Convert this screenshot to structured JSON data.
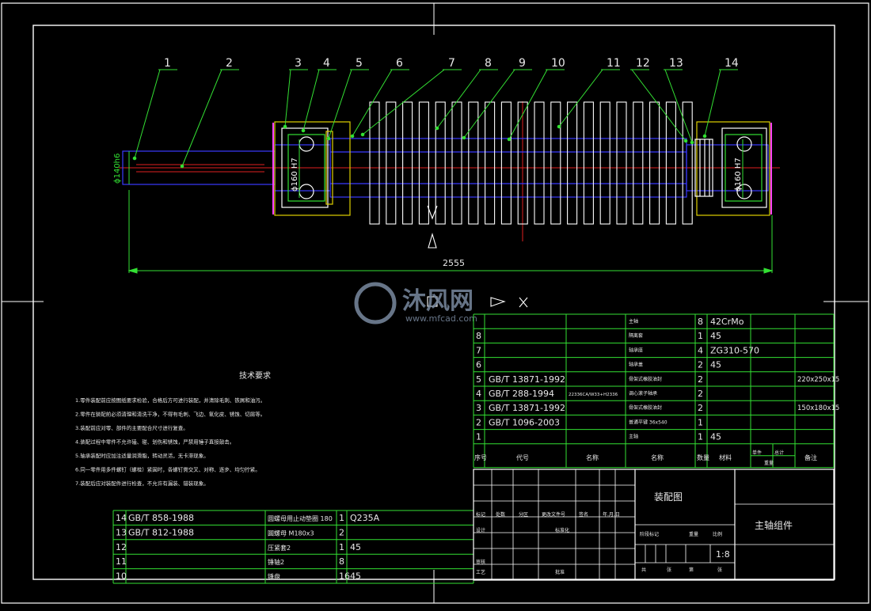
{
  "colors": {
    "background": "#000000",
    "frame": "#ffffff",
    "green": "#33e033",
    "blue": "#3a3aff",
    "red": "#e02020",
    "magenta": "#ff40ff",
    "yellow": "#e0d000",
    "text": "#e8e8e8",
    "watermark": "#7a8aa0"
  },
  "balloons": [
    "1",
    "2",
    "3",
    "4",
    "5",
    "6",
    "7",
    "8",
    "9",
    "10",
    "11",
    "12",
    "13",
    "14"
  ],
  "dimensions": {
    "shaft_diameter": "ϕ140h6",
    "bearing_left": "ϕ160 H7",
    "bearing_right": "ϕ160 H7",
    "overall_length": "2555"
  },
  "watermark": {
    "brand": "沐风网",
    "url": "www.mfcad.com"
  },
  "tech_requirements": {
    "title": "技术要求",
    "items": [
      "1.零件装配前应按图纸要求检验，合格后方可进行装配，并清除毛刺、铁屑和油污。",
      "2.零件在装配前必须清理和清洗干净，不得有毛刺、飞边、氧化皮、锈蚀、切屑等。",
      "3.装配前应对零、部件的主要配合尺寸进行复查。",
      "4.装配过程中零件不允许磕、碰、划伤和锈蚀，严禁用锤子直接敲击。",
      "5.轴承装配时应加注适量润滑脂，转动灵活，无卡滞现象。",
      "6.同一零件用多件螺钉（螺栓）紧固时，各螺钉需交叉、对称、逐步、均匀拧紧。",
      "7.装配后应对装配件进行检查，不允许有漏装、错装现象。"
    ]
  },
  "bom_upper": {
    "header": [
      "序号",
      "代号",
      "名称",
      "数量",
      "材料",
      "单件",
      "总计",
      "备注"
    ],
    "header_sub": [
      "重量"
    ],
    "rows": [
      {
        "no": "",
        "code": "",
        "name": "主轴",
        "qty": "8",
        "mat": "42CrMo",
        "note": ""
      },
      {
        "no": "8",
        "code": "",
        "name": "隔离套",
        "qty": "1",
        "mat": "45",
        "note": ""
      },
      {
        "no": "7",
        "code": "",
        "name": "轴承座",
        "qty": "4",
        "mat": "ZG310-570",
        "note": ""
      },
      {
        "no": "6",
        "code": "",
        "name": "轴承盖",
        "qty": "2",
        "mat": "45",
        "note": ""
      },
      {
        "no": "5",
        "code": "GB/T 13871-1992",
        "name": "骨架式橡胶油封",
        "qty": "2",
        "mat": "",
        "note": "220x250x15"
      },
      {
        "no": "4",
        "code": "GB/T 288-1994",
        "name": "调心滚子轴承",
        "qty": "2",
        "mat": "",
        "note": ""
      },
      {
        "no": "3",
        "code": "GB/T 13871-1992",
        "name": "骨架式橡胶油封",
        "qty": "2",
        "mat": "",
        "note": "150x180x15"
      },
      {
        "no": "2",
        "code": "GB/T 1096-2003",
        "name": "普通平键 36x540",
        "qty": "1",
        "mat": "",
        "note": ""
      },
      {
        "no": "1",
        "code": "",
        "name": "主轴",
        "qty": "1",
        "mat": "45",
        "note": ""
      }
    ],
    "row4_extra": "22336CA/W33+H2336"
  },
  "bom_lower": {
    "rows": [
      {
        "no": "14",
        "code": "GB/T 858-1988",
        "name": "圆螺母用止动垫圈 180",
        "qty": "1",
        "mat": "Q235A"
      },
      {
        "no": "13",
        "code": "GB/T 812-1988",
        "name": "圆螺母 M180x3",
        "qty": "2",
        "mat": ""
      },
      {
        "no": "12",
        "code": "",
        "name": "压紧套2",
        "qty": "1",
        "mat": "45"
      },
      {
        "no": "11",
        "code": "",
        "name": "锤轴2",
        "qty": "8",
        "mat": ""
      },
      {
        "no": "10",
        "code": "",
        "name": "锤盘",
        "qty": "16",
        "mat": "45"
      }
    ]
  },
  "title_block": {
    "drawing_type": "装配图",
    "part_name": "主轴组件",
    "scale": "1:8",
    "labels": {
      "mark": "标记",
      "count": "处数",
      "zone": "分区",
      "change_doc": "更改文件号",
      "sign": "签名",
      "date": "年.月.日",
      "design": "设计",
      "standardize": "标准化",
      "stage_mark": "阶段标记",
      "weight": "重量",
      "ratio": "比例",
      "review": "审核",
      "process": "工艺",
      "approve": "批准",
      "total": "共",
      "sheet": "张",
      "page": "第"
    }
  }
}
